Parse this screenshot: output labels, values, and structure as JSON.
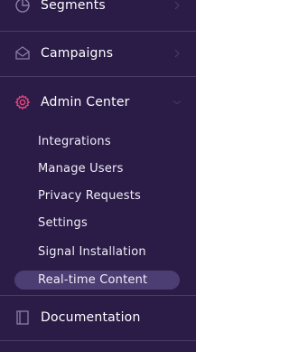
{
  "nav": {
    "segments_label": "Segments",
    "campaigns_label": "Campaigns",
    "admin_center_label": "Admin Center",
    "documentation_label": "Documentation"
  },
  "admin_center": {
    "items": [
      {
        "label": "Integrations"
      },
      {
        "label": "Manage Users"
      },
      {
        "label": "Privacy Requests"
      },
      {
        "label": "Settings"
      },
      {
        "label": "Signal Installation"
      },
      {
        "label": "Real-time Content"
      }
    ],
    "active_item": "Real-time Content"
  },
  "colors": {
    "sidebar_bg": "#2a1b47",
    "accent_pink": "#e8457a",
    "active_pill": "#4c3d72",
    "divider": "#4a3c66",
    "muted_icon": "#8a7fa6"
  },
  "icons": {
    "segments": "segments-icon",
    "campaigns": "campaigns-icon",
    "admin_center": "gear-icon",
    "documentation": "document-icon"
  }
}
